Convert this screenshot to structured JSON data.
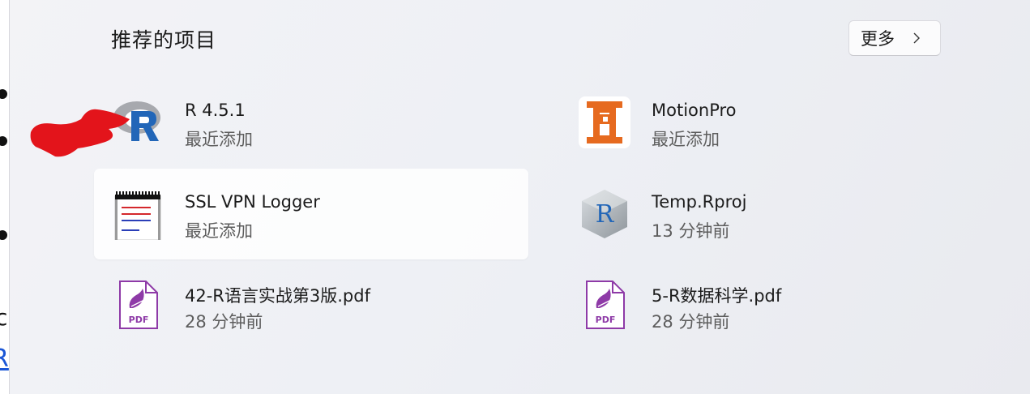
{
  "background_doc": {
    "fragment_text": "c",
    "link_text": "R"
  },
  "section": {
    "title": "推荐的项目",
    "more_label": "更多"
  },
  "items": [
    {
      "name": "R 4.5.1",
      "sub": "最近添加",
      "icon": "r-logo-icon"
    },
    {
      "name": "MotionPro",
      "sub": "最近添加",
      "icon": "motionpro-icon"
    },
    {
      "name": "SSL VPN Logger",
      "sub": "最近添加",
      "icon": "notepad-log-icon"
    },
    {
      "name": "Temp.Rproj",
      "sub": "13 分钟前",
      "icon": "rproj-file-icon"
    },
    {
      "name": "42-R语言实战第3版.pdf",
      "sub": "28 分钟前",
      "icon": "pdf-file-icon"
    },
    {
      "name": "5-R数据科学.pdf",
      "sub": "28 分钟前",
      "icon": "pdf-file-icon"
    }
  ],
  "colors": {
    "annotation_red": "#e3141b",
    "motionpro_orange": "#e66a1f",
    "r_blue": "#2266b8",
    "pdf_purple": "#8e3aa7"
  }
}
